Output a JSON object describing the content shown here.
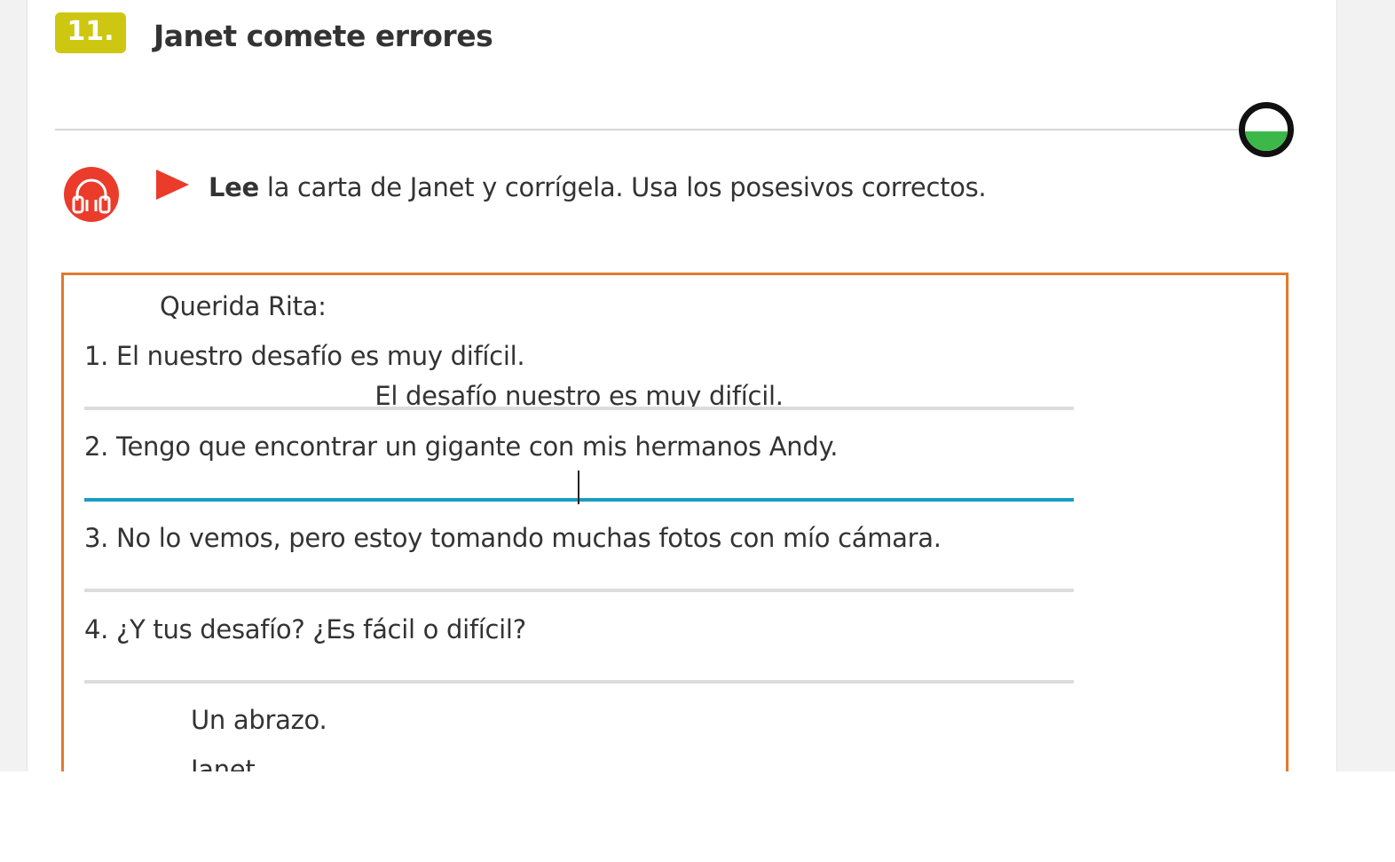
{
  "exercise": {
    "number": "11.",
    "title": "Janet comete errores",
    "progress_fraction": 0.45
  },
  "colors": {
    "badge": "#cdc712",
    "audio_button": "#ea3b2b",
    "play_arrow": "#ea3b2b",
    "letter_border": "#e07b2e",
    "active_underline": "#1a9cc4",
    "progress_fill": "#3cb84a"
  },
  "icons": {
    "audio": "headphones-icon",
    "play": "play-triangle-icon"
  },
  "instruction": {
    "bold": "Lee",
    "rest": " la carta de Janet y corrígela. Usa los posesivos correctos."
  },
  "letter": {
    "greeting": "Querida Rita:",
    "items": [
      {
        "prompt": "1. El nuestro desafío es muy difícil.",
        "answer": "El desafío nuestro es muy difícil."
      },
      {
        "prompt": "2. Tengo que encontrar un gigante con mis hermanos Andy.",
        "answer": ""
      },
      {
        "prompt": "3. No lo vemos, pero estoy tomando muchas fotos con mío cámara.",
        "answer": ""
      },
      {
        "prompt": "4. ¿Y tus desafío? ¿Es fácil o difícil?",
        "answer": ""
      }
    ],
    "closing": "Un abrazo.",
    "signature": "Janet"
  }
}
